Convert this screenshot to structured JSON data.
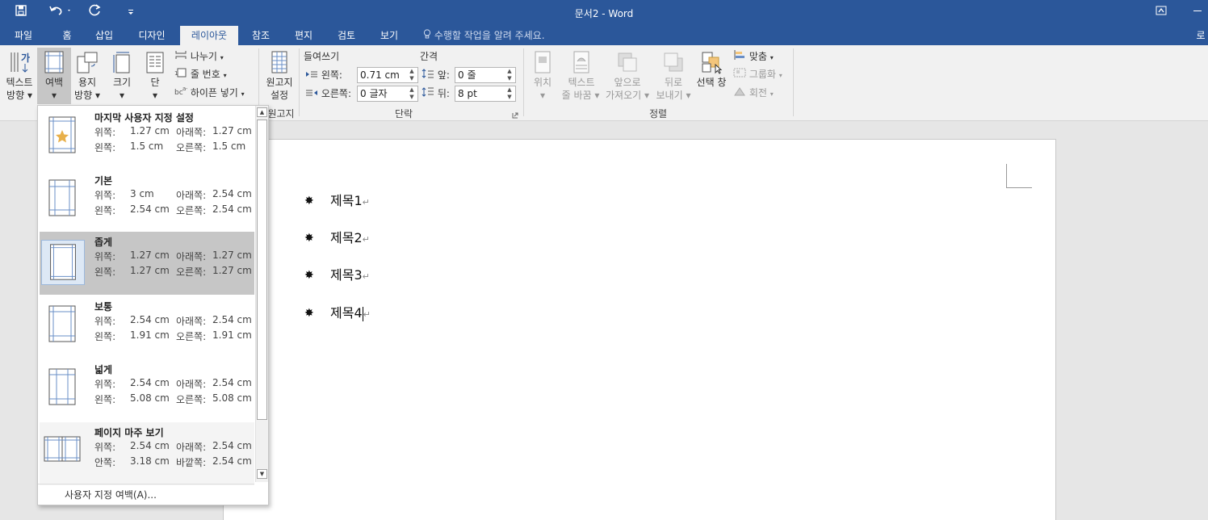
{
  "window": {
    "title": "문서2 - Word",
    "user_partial": "로"
  },
  "quick_access": {
    "save": "save-icon",
    "undo": "undo-icon",
    "redo": "redo-icon",
    "customize": "customize-icon"
  },
  "tabs": [
    "파일",
    "홈",
    "삽입",
    "디자인",
    "레이아웃",
    "참조",
    "편지",
    "검토",
    "보기"
  ],
  "active_tab": "레이아웃",
  "tell_me": "수행할 작업을 알려 주세요.",
  "ribbon": {
    "page_setup": {
      "text_direction": [
        "텍스트",
        "방향"
      ],
      "margins": "여백",
      "orientation": [
        "용지",
        "방향"
      ],
      "size": "크기",
      "columns": "단",
      "breaks": "나누기",
      "line_numbers": "줄 번호",
      "hyphenation": "하이픈 넣기"
    },
    "manuscript": {
      "settings": [
        "원고지",
        "설정"
      ],
      "group_label": "원고지"
    },
    "paragraph": {
      "indent_label": "들여쓰기",
      "spacing_label": "간격",
      "left_label": "왼쪽:",
      "left_value": "0.71 cm",
      "right_label": "오른쪽:",
      "right_value": "0 글자",
      "before_label": "앞:",
      "before_value": "0 줄",
      "after_label": "뒤:",
      "after_value": "8 pt",
      "group_label": "단락"
    },
    "arrange": {
      "position": "위치",
      "wrap_text": [
        "텍스트",
        "줄 바꿈"
      ],
      "bring_forward": [
        "앞으로",
        "가져오기"
      ],
      "send_backward": [
        "뒤로",
        "보내기"
      ],
      "selection_pane": "선택 창",
      "align": "맞춤",
      "group": "그룹화",
      "rotate": "회전",
      "group_label": "정렬"
    }
  },
  "margins_menu": {
    "items": [
      {
        "name": "마지막 사용자 지정 설정",
        "line1_a_label": "위쪽:",
        "line1_a_value": "1.27 cm",
        "line1_b_label": "아래쪽:",
        "line1_b_value": "1.27 cm",
        "line2_a_label": "왼쪽:",
        "line2_a_value": "1.5 cm",
        "line2_b_label": "오른쪽:",
        "line2_b_value": "1.5 cm"
      },
      {
        "name": "기본",
        "line1_a_label": "위쪽:",
        "line1_a_value": "3 cm",
        "line1_b_label": "아래쪽:",
        "line1_b_value": "2.54 cm",
        "line2_a_label": "왼쪽:",
        "line2_a_value": "2.54 cm",
        "line2_b_label": "오른쪽:",
        "line2_b_value": "2.54 cm"
      },
      {
        "name": "좁게",
        "line1_a_label": "위쪽:",
        "line1_a_value": "1.27 cm",
        "line1_b_label": "아래쪽:",
        "line1_b_value": "1.27 cm",
        "line2_a_label": "왼쪽:",
        "line2_a_value": "1.27 cm",
        "line2_b_label": "오른쪽:",
        "line2_b_value": "1.27 cm"
      },
      {
        "name": "보통",
        "line1_a_label": "위쪽:",
        "line1_a_value": "2.54 cm",
        "line1_b_label": "아래쪽:",
        "line1_b_value": "2.54 cm",
        "line2_a_label": "왼쪽:",
        "line2_a_value": "1.91 cm",
        "line2_b_label": "오른쪽:",
        "line2_b_value": "1.91 cm"
      },
      {
        "name": "넓게",
        "line1_a_label": "위쪽:",
        "line1_a_value": "2.54 cm",
        "line1_b_label": "아래쪽:",
        "line1_b_value": "2.54 cm",
        "line2_a_label": "왼쪽:",
        "line2_a_value": "5.08 cm",
        "line2_b_label": "오른쪽:",
        "line2_b_value": "5.08 cm"
      },
      {
        "name": "페이지 마주 보기",
        "line1_a_label": "위쪽:",
        "line1_a_value": "2.54 cm",
        "line1_b_label": "아래쪽:",
        "line1_b_value": "2.54 cm",
        "line2_a_label": "안쪽:",
        "line2_a_value": "3.18 cm",
        "line2_b_label": "바깥쪽:",
        "line2_b_value": "2.54 cm"
      }
    ],
    "selected": "좁게",
    "custom": "사용자 지정 여백(A)..."
  },
  "document": {
    "paragraphs": [
      "제목1",
      "제목2",
      "제목3",
      "제목4"
    ],
    "bullet": "✸",
    "para_mark": "↵"
  },
  "colors": {
    "accent": "#2b579a",
    "selected_item": "#c6c6c6",
    "star": "#e8b04a"
  }
}
